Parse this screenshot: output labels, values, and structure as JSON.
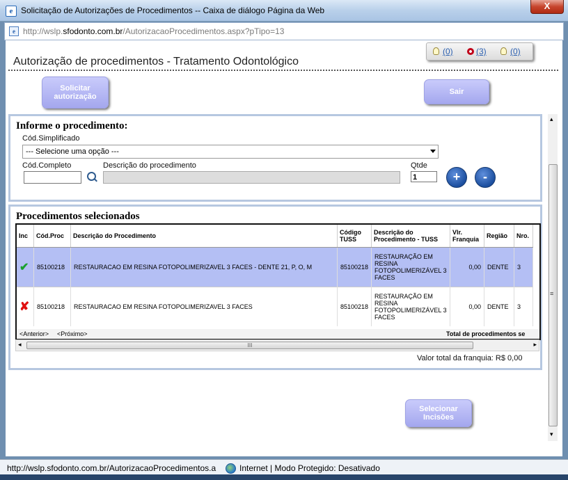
{
  "window": {
    "title": "Solicitação de Autorizações de Procedimentos -- Caixa de diálogo Página da Web",
    "close_label": "X",
    "address_prefix": "http://wslp.",
    "address_domain": "sfodonto.com.br",
    "address_suffix": "/AutorizacaoProcedimentos.aspx?pTipo=13"
  },
  "header": {
    "page_title": "Autorização de procedimentos - Tratamento Odontológico",
    "notifications": [
      {
        "label": "(0)",
        "icon": "bulb-icon"
      },
      {
        "label": "(3)",
        "icon": "alert-star-icon"
      },
      {
        "label": "(0)",
        "icon": "bulb-icon"
      }
    ],
    "solicitar_label": "Solicitar autorização",
    "sair_label": "Sair"
  },
  "procedure_form": {
    "heading": "Informe o procedimento:",
    "cod_simplificado_label": "Cód.Simplificado",
    "select_value": "--- Selecione uma opção ---",
    "cod_completo_label": "Cód.Completo",
    "cod_completo_value": "",
    "descricao_label": "Descrição do procedimento",
    "descricao_value": "",
    "qtde_label": "Qtde",
    "qtde_value": "1",
    "add_label": "+",
    "remove_label": "-"
  },
  "selected": {
    "heading": "Procedimentos selecionados",
    "columns": [
      "Inc",
      "Cód.Proc",
      "Descrição do Procedimento",
      "Código TUSS",
      "Descrição do Procedimento - TUSS",
      "Vlr. Franquia",
      "Região",
      "Nro."
    ],
    "rows": [
      {
        "inc": "check",
        "cod_proc": "85100218",
        "descricao": "RESTAURACAO EM RESINA FOTOPOLIMERIZAVEL 3 FACES - DENTE 21, P, O, M",
        "tuss": "85100218",
        "descricao_tuss": "RESTAURAÇÃO EM RESINA FOTOPOLIMERIZÁVEL 3 FACES",
        "franquia": "0,00",
        "regiao": "DENTE",
        "nro": "3"
      },
      {
        "inc": "x",
        "cod_proc": "85100218",
        "descricao": "RESTAURACAO EM RESINA FOTOPOLIMERIZAVEL 3 FACES",
        "tuss": "85100218",
        "descricao_tuss": "RESTAURAÇÃO EM RESINA FOTOPOLIMERIZÁVEL 3 FACES",
        "franquia": "0,00",
        "regiao": "DENTE",
        "nro": "3"
      }
    ],
    "pager_prev": "<Anterior>",
    "pager_next": "<Próximo>",
    "total_label": "Total de procedimentos se",
    "hscroll_grip": "III",
    "valor_total": "Valor total da franquia: R$ 0,00"
  },
  "footer_button": "Selecionar Incisões",
  "vscroll_grip": "≡",
  "status": {
    "url": "http://wslp.sfodonto.com.br/AutorizacaoProcedimentos.a",
    "zone": "Internet | Modo Protegido: Desativado"
  },
  "colors": {
    "button_fill": "#a9acf0",
    "selected_row": "#b4bff4",
    "panel_border": "#b6c7e0"
  }
}
